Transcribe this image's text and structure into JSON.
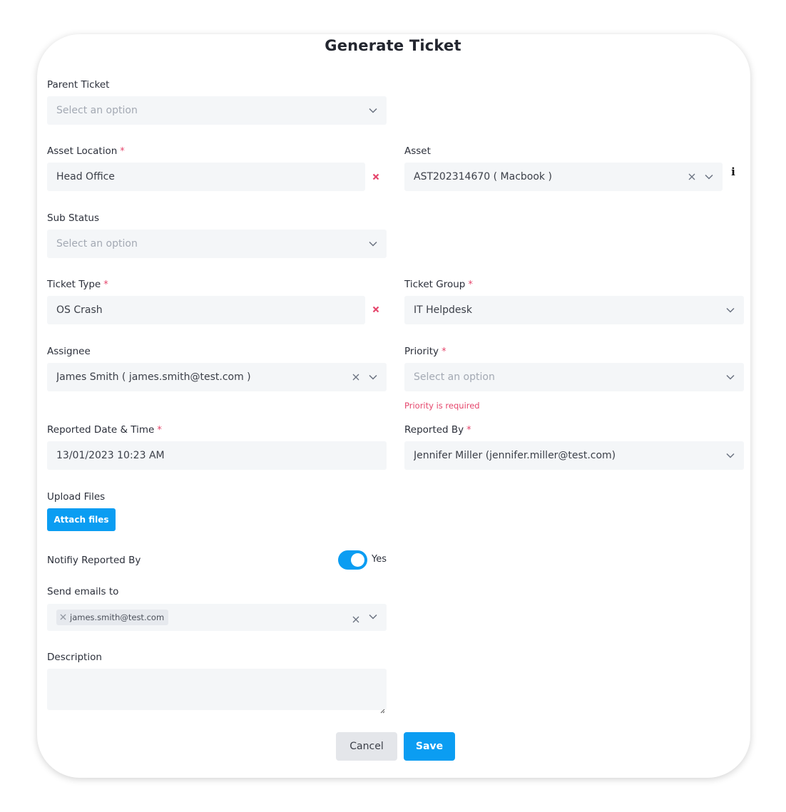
{
  "title": "Generate Ticket",
  "required_mark": "*",
  "parent_ticket": {
    "label": "Parent Ticket",
    "placeholder": "Select an option"
  },
  "asset_location": {
    "label": "Asset Location",
    "value": "Head Office"
  },
  "asset": {
    "label": "Asset",
    "value": "AST202314670 ( Macbook )"
  },
  "sub_status": {
    "label": "Sub Status",
    "placeholder": "Select an option"
  },
  "ticket_type": {
    "label": "Ticket Type",
    "value": "OS Crash"
  },
  "ticket_group": {
    "label": "Ticket Group",
    "value": "IT Helpdesk"
  },
  "assignee": {
    "label": "Assignee",
    "value": "James Smith ( james.smith@test.com )"
  },
  "priority": {
    "label": "Priority",
    "placeholder": "Select an option",
    "error": "Priority is required"
  },
  "reported_date": {
    "label": "Reported Date & Time",
    "value": "13/01/2023 10:23 AM"
  },
  "reported_by": {
    "label": "Reported By",
    "value": "Jennifer Miller (jennifer.miller@test.com)"
  },
  "upload": {
    "label": "Upload Files",
    "button": "Attach files"
  },
  "notify": {
    "label": "Notifiy Reported By",
    "toggle_text": "Yes",
    "enabled": true
  },
  "send_emails": {
    "label": "Send emails to",
    "chips": [
      "james.smith@test.com"
    ]
  },
  "description": {
    "label": "Description"
  },
  "actions": {
    "cancel": "Cancel",
    "save": "Save"
  },
  "colors": {
    "primary": "#0b9df2",
    "error": "#e5466c",
    "field_bg": "#f4f6f8"
  },
  "icons": {
    "dropdown": "chevron-down-icon",
    "clear": "close-icon",
    "remove": "remove-x-icon",
    "info": "info-icon"
  }
}
